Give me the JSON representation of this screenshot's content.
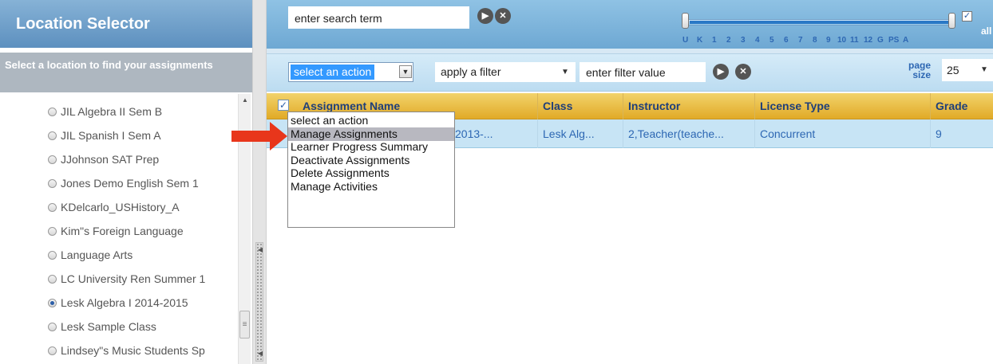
{
  "left_panel": {
    "title": "Location Selector",
    "instruction": "Select a location to find your assignments",
    "locations": [
      {
        "label": "JIL Algebra II Sem B",
        "selected": false
      },
      {
        "label": "JIL Spanish I Sem A",
        "selected": false
      },
      {
        "label": "JJohnson SAT Prep",
        "selected": false
      },
      {
        "label": "Jones Demo English Sem 1",
        "selected": false
      },
      {
        "label": "KDelcarlo_USHistory_A",
        "selected": false
      },
      {
        "label": "Kim\"s Foreign Language",
        "selected": false
      },
      {
        "label": "Language Arts",
        "selected": false
      },
      {
        "label": "LC University Ren Summer 1",
        "selected": false
      },
      {
        "label": "Lesk Algebra I 2014-2015",
        "selected": true
      },
      {
        "label": "Lesk Sample Class",
        "selected": false
      },
      {
        "label": "Lindsey\"s Music Students Sp",
        "selected": false
      }
    ]
  },
  "search": {
    "value": "enter search term"
  },
  "grade_filter": {
    "ticks": [
      "U",
      "K",
      "1",
      "2",
      "3",
      "4",
      "5",
      "6",
      "7",
      "8",
      "9",
      "10",
      "11",
      "12",
      "G",
      "PS",
      "A"
    ],
    "all_label": "all",
    "all_checked": true,
    "range": [
      "U",
      "A"
    ]
  },
  "toolbar": {
    "action_select_value": "select an action",
    "filter_select_value": "apply a filter",
    "filter_value": "enter filter value",
    "page_size_label_1": "page",
    "page_size_label_2": "size",
    "page_size_value": "25"
  },
  "action_menu": {
    "items": [
      "select an action",
      "Manage Assignments",
      "Learner Progress Summary",
      "Deactivate Assignments",
      "Delete Assignments",
      "Manage Activities"
    ],
    "hover_index": 1
  },
  "grid": {
    "columns": [
      "Assignment Name",
      "Class",
      "Instructor",
      "License Type",
      "Grade"
    ],
    "rows": [
      {
        "assignment_name": "2013-...",
        "class": "Lesk Alg...",
        "instructor": "2,Teacher(teache...",
        "license_type": "Concurrent",
        "grade": "9"
      }
    ]
  },
  "colors": {
    "accent_blue": "#2d67b3",
    "header_gold": "#e1aa27",
    "annotation_red": "#e8361b"
  }
}
